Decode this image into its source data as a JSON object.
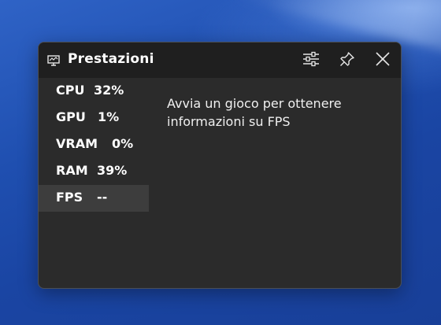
{
  "widget": {
    "title": "Prestazioni",
    "icons": {
      "title": "monitor-icon",
      "settings": "sliders-icon",
      "pin": "pin-icon",
      "close": "close-icon"
    }
  },
  "metrics": [
    {
      "label": "CPU",
      "value": "32%"
    },
    {
      "label": "GPU",
      "value": "1%"
    },
    {
      "label": "VRAM",
      "value": "0%"
    },
    {
      "label": "RAM",
      "value": "39%"
    },
    {
      "label": "FPS",
      "value": "--",
      "selected": true
    }
  ],
  "message": "Avvia un gioco per ottenere informazioni su FPS",
  "colors": {
    "desktop": "#1f4fb0",
    "panel": "#2b2b2b",
    "titlebar": "#1f1f1f",
    "selected_row": "#3d3d3d",
    "text": "#ffffff"
  }
}
